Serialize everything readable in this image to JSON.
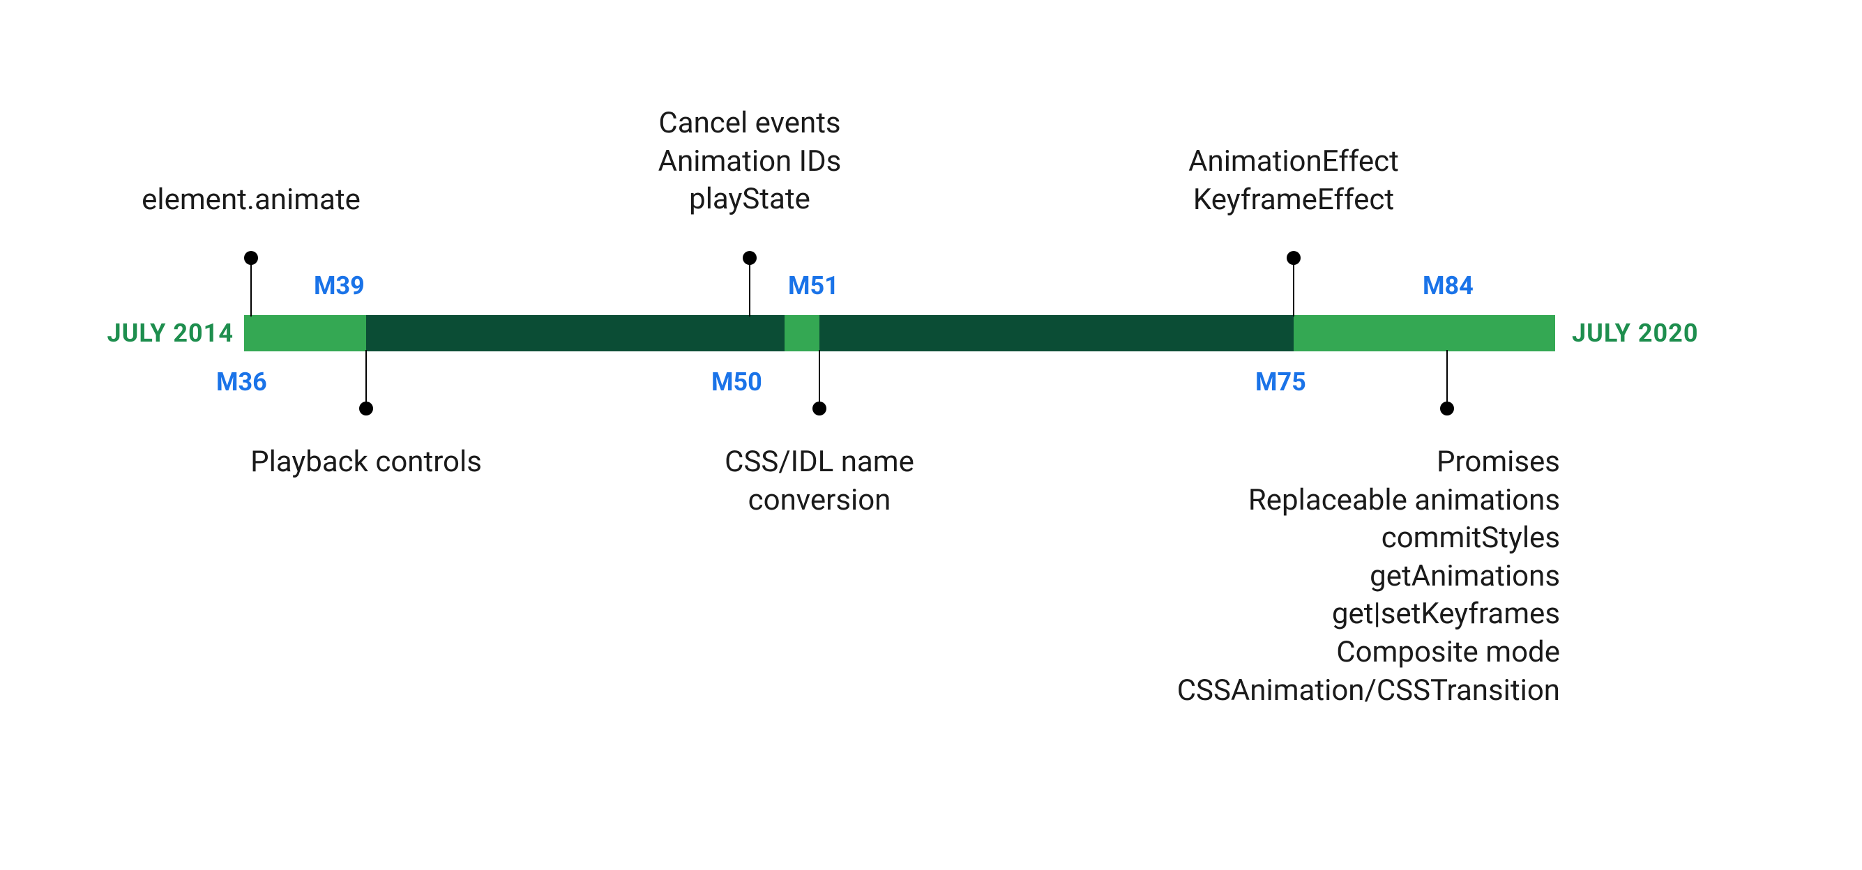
{
  "timeline": {
    "start_label": "JULY 2014",
    "end_label": "JULY 2020",
    "milestones": {
      "m36": "M36",
      "m39": "M39",
      "m50": "M50",
      "m51": "M51",
      "m75": "M75",
      "m84": "M84"
    },
    "events": {
      "m36_l1": "element.animate",
      "m39_l1": "Playback controls",
      "m50_l1": "CSS/IDL name",
      "m50_l2": "conversion",
      "m51_l1": "Cancel events",
      "m51_l2": "Animation IDs",
      "m51_l3": "playState",
      "m75_l1": "AnimationEffect",
      "m75_l2": "KeyframeEffect",
      "m84_l1": "Promises",
      "m84_l2": "Replaceable animations",
      "m84_l3": "commitStyles",
      "m84_l4": "getAnimations",
      "m84_l5": "get|setKeyframes",
      "m84_l6": "Composite mode",
      "m84_l7": "CSSAnimation/CSSTransition"
    }
  },
  "chart_data": {
    "type": "timeline",
    "title": "Web Animations API milestones in Chrome",
    "range": {
      "start": "2014-07",
      "end": "2020-07"
    },
    "events": [
      {
        "milestone": "M36",
        "side": "above",
        "features": [
          "element.animate"
        ]
      },
      {
        "milestone": "M39",
        "side": "below",
        "features": [
          "Playback controls"
        ]
      },
      {
        "milestone": "M50",
        "side": "below",
        "features": [
          "CSS/IDL name conversion"
        ]
      },
      {
        "milestone": "M51",
        "side": "above",
        "features": [
          "Cancel events",
          "Animation IDs",
          "playState"
        ]
      },
      {
        "milestone": "M75",
        "side": "above",
        "features": [
          "AnimationEffect",
          "KeyframeEffect"
        ]
      },
      {
        "milestone": "M84",
        "side": "below",
        "features": [
          "Promises",
          "Replaceable animations",
          "commitStyles",
          "getAnimations",
          "get|setKeyframes",
          "Composite mode",
          "CSSAnimation/CSSTransition"
        ]
      }
    ]
  }
}
